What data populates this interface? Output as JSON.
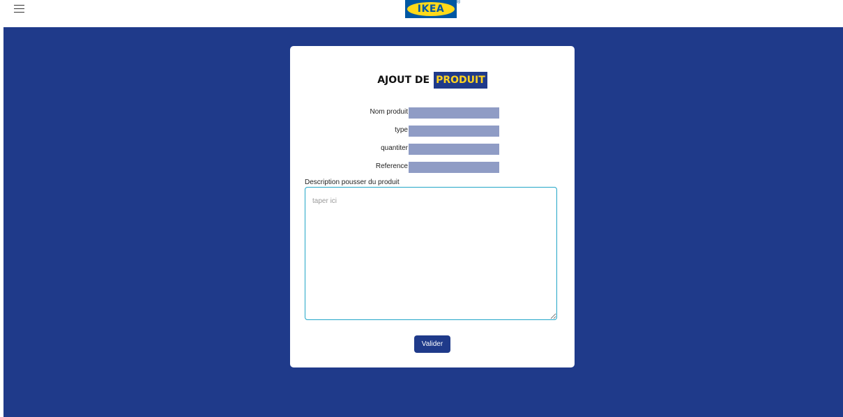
{
  "header": {
    "menu_icon": "hamburger-menu-icon",
    "logo_text": "IKEA",
    "logo_mark": "®",
    "colors": {
      "logo_blue": "#0058a3",
      "logo_yellow": "#ffda1a"
    }
  },
  "page": {
    "background_color": "#1f3a8a"
  },
  "form": {
    "title_part1": "AJOUT DE",
    "title_part2": "PRODUIT",
    "fields": [
      {
        "label": "Nom produit",
        "value": ""
      },
      {
        "label": "type",
        "value": ""
      },
      {
        "label": "quantiter",
        "value": ""
      },
      {
        "label": "Reference",
        "value": ""
      }
    ],
    "description": {
      "label": "Description pousser du produit",
      "placeholder": "taper ici",
      "value": ""
    },
    "submit_label": "Valider",
    "colors": {
      "accent": "#1f3a8a",
      "highlight": "#ffd21f",
      "input_fill": "#8f9cc5",
      "focus_border": "#22a6c8"
    }
  }
}
